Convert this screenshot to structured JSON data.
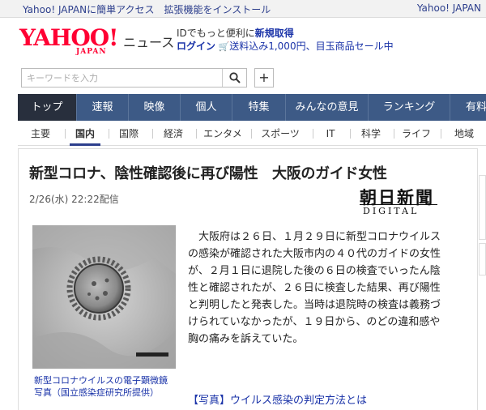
{
  "promo": {
    "left_text": "Yahoo! JAPANに簡単アクセス　拡張機能をインストール",
    "right_text": "Yahoo! JAPAN"
  },
  "logo": {
    "brand": "YAHOO!",
    "sub": "JAPAN",
    "section": "ニュース"
  },
  "account": {
    "prefix": "IDでもっと便利に",
    "register": "新規取得",
    "login": "ログイン",
    "cart_icon": "cart-icon",
    "promo": "送料込み1,000円、目玉商品セール中"
  },
  "search": {
    "placeholder": "キーワードを入力",
    "icon": "search-icon",
    "plus": "+"
  },
  "mainnav": [
    "トップ",
    "速報",
    "映像",
    "個人",
    "特集",
    "みんなの意見",
    "ランキング",
    "有料"
  ],
  "subnav": [
    "主要",
    "国内",
    "国際",
    "経済",
    "エンタメ",
    "スポーツ",
    "IT",
    "科学",
    "ライフ",
    "地域"
  ],
  "article": {
    "title": "新型コロナ、陰性確認後に再び陽性　大阪のガイド女性",
    "date": "2/26(水) 22:22配信",
    "publisher_kanji": "朝日新聞",
    "publisher_sub": "DIGITAL",
    "caption_line1": "新型コロナウイルスの電子顕微鏡",
    "caption_line2": "写真（国立感染症研究所提供）",
    "body": "大阪府は２６日、１月２９日に新型コロナウイルスの感染が確認された大阪市内の４０代のガイドの女性が、２月１日に退院した後の６日の検査でいったん陰性と確認されたが、２６日に検査した結果、再び陽性と判明したと発表した。当時は退院時の検査は義務づけられていなかったが、１９日から、のどの違和感や胸の痛みを訴えていた。",
    "related_link": "【写真】ウイルス感染の判定方法とは"
  },
  "colors": {
    "nav": "#3d5a86",
    "nav_active": "#282f3d",
    "brand": "#ff0033",
    "link": "#1a33a8"
  }
}
